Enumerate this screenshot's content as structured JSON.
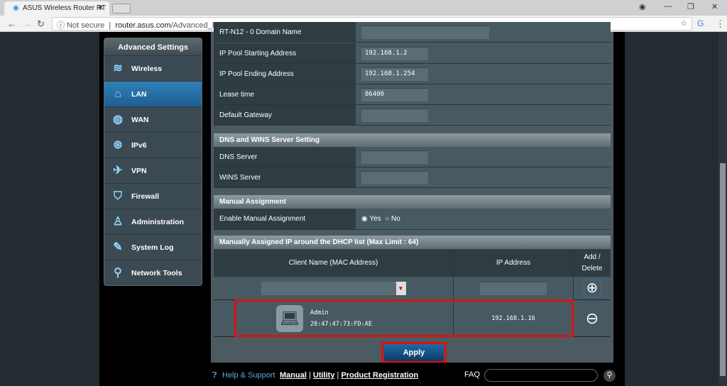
{
  "browser": {
    "tab_title": "ASUS Wireless Router RT",
    "security": "Not secure",
    "url_host": "router.asus.com",
    "url_path": "/Advanced_DHCP_Content.asp"
  },
  "sidebar": {
    "title": "Advanced Settings",
    "items": [
      {
        "label": "Wireless",
        "icon": "wifi-icon"
      },
      {
        "label": "LAN",
        "icon": "home-icon",
        "selected": true
      },
      {
        "label": "WAN",
        "icon": "globe-icon"
      },
      {
        "label": "IPv6",
        "icon": "ipv6-icon"
      },
      {
        "label": "VPN",
        "icon": "vpn-icon"
      },
      {
        "label": "Firewall",
        "icon": "shield-icon"
      },
      {
        "label": "Administration",
        "icon": "user-icon"
      },
      {
        "label": "System Log",
        "icon": "log-icon"
      },
      {
        "label": "Network Tools",
        "icon": "tools-icon"
      }
    ]
  },
  "dhcp": {
    "partial_label": "RT-N12 - 0 Domain Name",
    "start_label": "IP Pool Starting Address",
    "start": "192.168.1.2",
    "end_label": "IP Pool Ending Address",
    "end": "192.168.1.254",
    "lease_label": "Lease time",
    "lease": "86400",
    "gateway_label": "Default Gateway",
    "gateway": ""
  },
  "dns": {
    "header": "DNS and WINS Server Setting",
    "dns_label": "DNS Server",
    "wins_label": "WINS Server"
  },
  "manual": {
    "header": "Manual Assignment",
    "enable_label": "Enable Manual Assignment",
    "yes": "Yes",
    "no": "No",
    "selected": "Yes"
  },
  "list": {
    "header": "Manually Assigned IP around the DHCP list (Max Limit : 64)",
    "col_client": "Client Name (MAC Address)",
    "col_ip": "IP Address",
    "col_add": "Add / Delete",
    "entries": [
      {
        "name": "Admin",
        "mac": "20:47:47:73:FD:AE",
        "ip": "192.168.1.16"
      }
    ]
  },
  "apply": "Apply",
  "footer": {
    "help": "Help & Support",
    "manual": "Manual",
    "utility": "Utility",
    "registration": "Product Registration",
    "faq": "FAQ"
  }
}
